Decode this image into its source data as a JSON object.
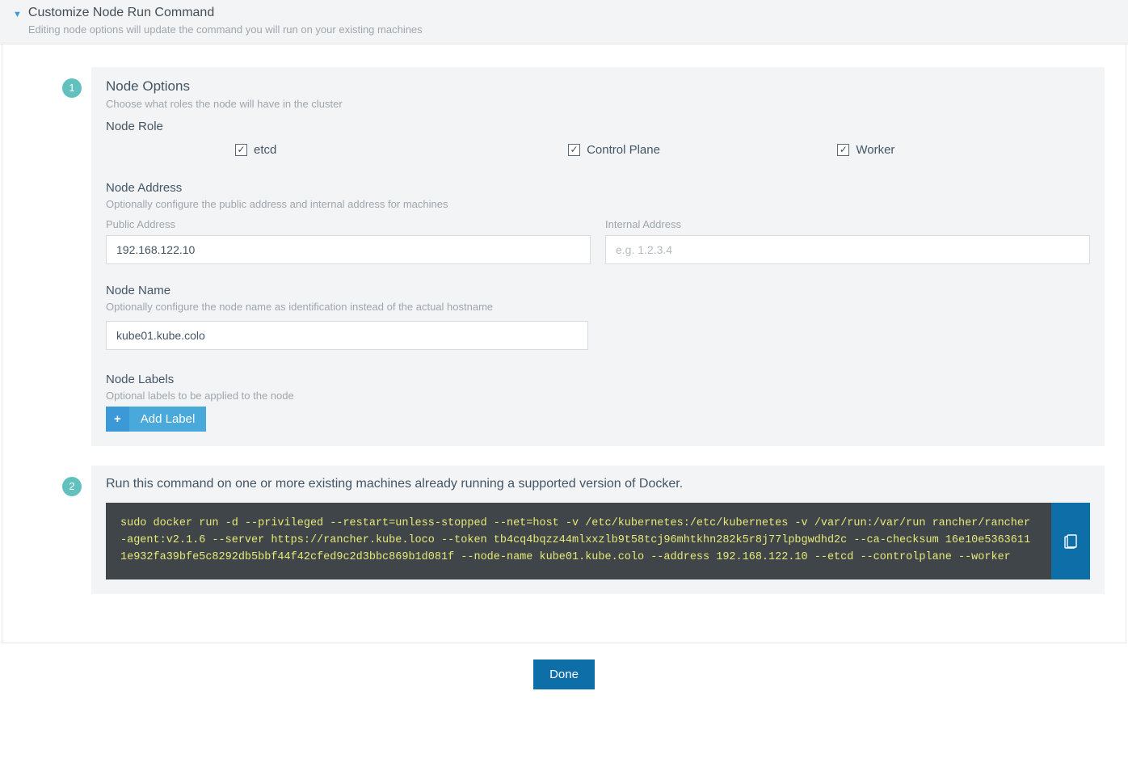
{
  "header": {
    "title": "Customize Node Run Command",
    "subtitle": "Editing node options will update the command you will run on your existing machines"
  },
  "step1": {
    "badge": "1",
    "title": "Node Options",
    "subtitle": "Choose what roles the node will have in the cluster",
    "nodeRole": {
      "label": "Node Role",
      "etcd": "etcd",
      "controlPlane": "Control Plane",
      "worker": "Worker"
    },
    "nodeAddress": {
      "label": "Node Address",
      "subtitle": "Optionally configure the public address and internal address for machines",
      "publicLabel": "Public Address",
      "publicValue": "192.168.122.10",
      "internalLabel": "Internal Address",
      "internalPlaceholder": "e.g. 1.2.3.4"
    },
    "nodeName": {
      "label": "Node Name",
      "subtitle": "Optionally configure the node name as identification instead of the actual hostname",
      "value": "kube01.kube.colo"
    },
    "nodeLabels": {
      "label": "Node Labels",
      "subtitle": "Optional labels to be applied to the node",
      "addLabel": "Add Label"
    }
  },
  "step2": {
    "badge": "2",
    "instruction": "Run this command on one or more existing machines already running a supported version of Docker.",
    "command": "sudo docker run -d --privileged --restart=unless-stopped --net=host -v /etc/kubernetes:/etc/kubernetes -v /var/run:/var/run rancher/rancher-agent:v2.1.6 --server https://rancher.kube.loco --token tb4cq4bqzz44mlxxzlb9t58tcj96mhtkhn282k5r8j77lpbgwdhd2c --ca-checksum 16e10e53636111e932fa39bfe5c8292db5bbf44f42cfed9c2d3bbc869b1d081f --node-name kube01.kube.colo --address 192.168.122.10 --etcd --controlplane --worker"
  },
  "footer": {
    "done": "Done"
  }
}
